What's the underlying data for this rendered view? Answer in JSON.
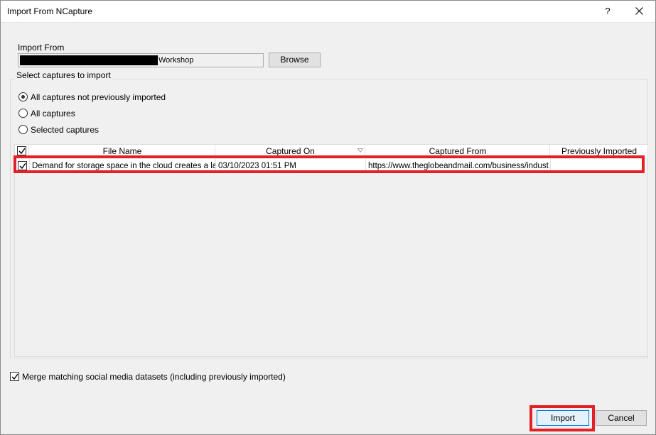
{
  "window": {
    "title": "Import From NCapture",
    "help_label": "?"
  },
  "import_from": {
    "label": "Import From",
    "path_visible_suffix": "Workshop",
    "browse_label": "Browse"
  },
  "selection": {
    "group_label": "Select captures to import",
    "options": [
      {
        "label": "All captures not previously imported",
        "checked": true
      },
      {
        "label": "All captures",
        "checked": false
      },
      {
        "label": "Selected captures",
        "checked": false
      }
    ]
  },
  "table": {
    "columns": [
      "File Name",
      "Captured On",
      "Captured From",
      "Previously Imported"
    ],
    "sort_column": "Captured On",
    "rows": [
      {
        "checked": true,
        "file_name": "Demand for storage space in the cloud creates a la",
        "captured_on": "03/10/2023 01:51 PM",
        "captured_from": "https://www.theglobeandmail.com/business/indust",
        "previously_imported": ""
      }
    ]
  },
  "merge": {
    "label": "Merge matching social media datasets (including previously imported)",
    "checked": true
  },
  "buttons": {
    "import_label": "Import",
    "cancel_label": "Cancel"
  },
  "colors": {
    "highlight": "#e51f27",
    "accent": "#0078d7"
  }
}
